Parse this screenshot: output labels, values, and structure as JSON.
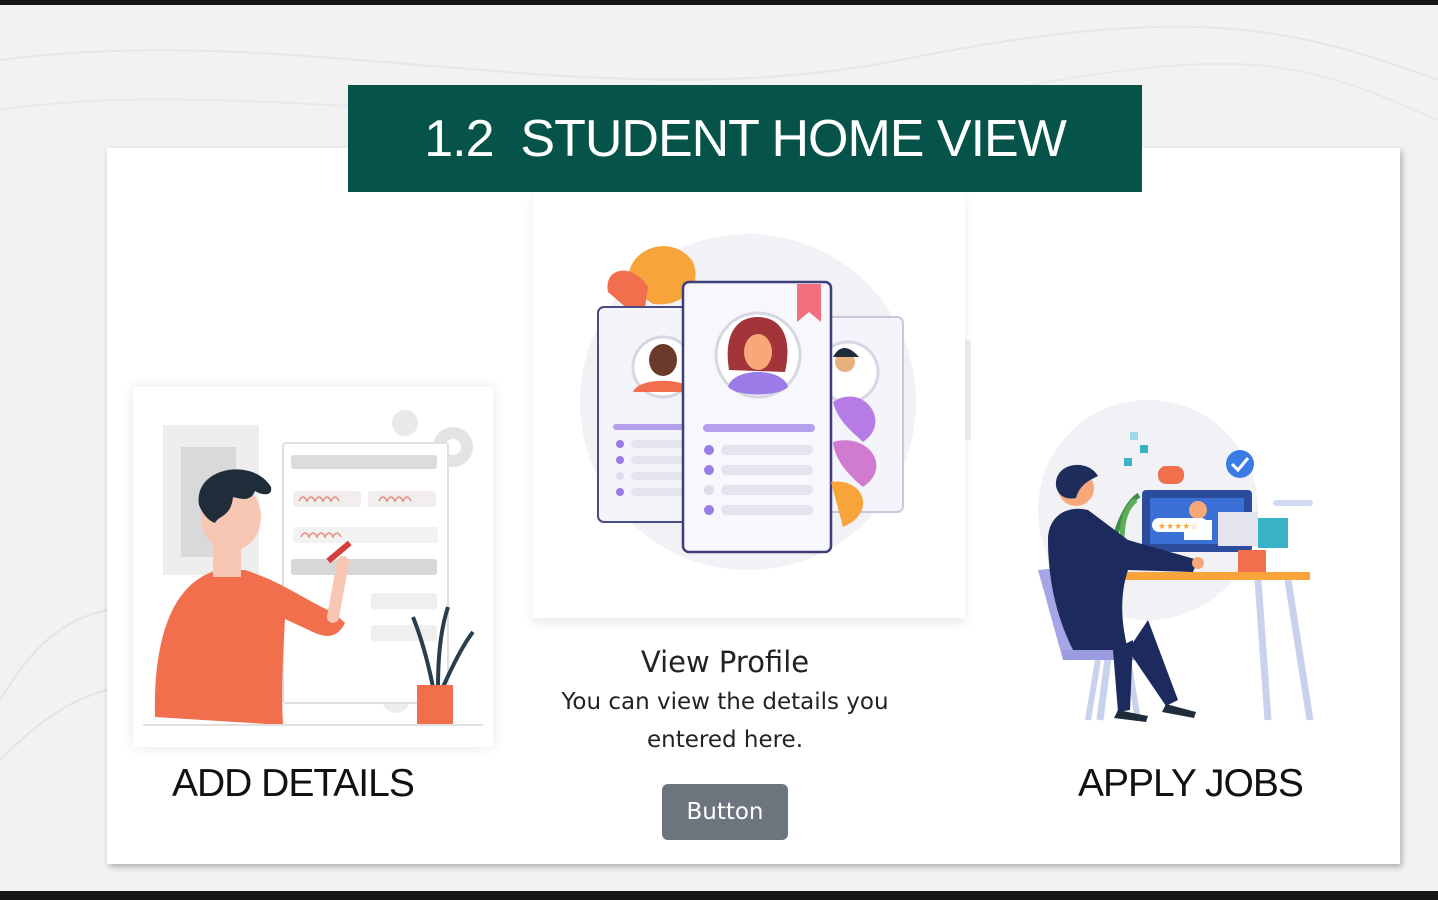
{
  "slide": {
    "title": "1.2  STUDENT HOME VIEW"
  },
  "left_panel": {
    "label": "ADD DETAILS",
    "illustration": "person-filling-form-illustration"
  },
  "center_card": {
    "title": "View Profile",
    "description": "You can view the details you entered here.",
    "button_label": "Button",
    "illustration": "profile-cards-illustration"
  },
  "right_panel": {
    "label": "APPLY JOBS",
    "illustration": "person-at-desk-video-call-illustration"
  },
  "colors": {
    "banner": "#06534a",
    "button": "#6c757d",
    "accent_orange": "#f26f4d",
    "accent_purple": "#9b7be6",
    "accent_navy": "#1d2a5d"
  }
}
